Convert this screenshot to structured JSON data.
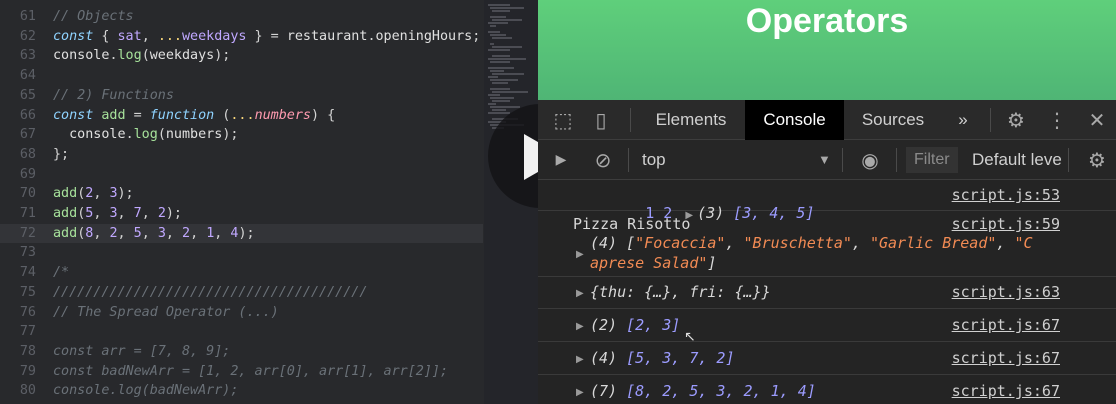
{
  "editor": {
    "lines": [
      {
        "num": "61",
        "tokens": [
          [
            "c",
            "// Objects"
          ]
        ]
      },
      {
        "num": "62",
        "tokens": [
          [
            "k",
            "const"
          ],
          [
            "p",
            " { "
          ],
          [
            "v",
            "sat"
          ],
          [
            "p",
            ", "
          ],
          [
            "o",
            "..."
          ],
          [
            "v",
            "weekdays"
          ],
          [
            "p",
            " } = "
          ],
          [
            "pr",
            "restaurant"
          ],
          [
            "p",
            "."
          ],
          [
            "pr",
            "openingHours"
          ],
          [
            "p",
            ";"
          ]
        ]
      },
      {
        "num": "63",
        "tokens": [
          [
            "pr",
            "console"
          ],
          [
            "p",
            "."
          ],
          [
            "fn",
            "log"
          ],
          [
            "p",
            "("
          ],
          [
            "pr",
            "weekdays"
          ],
          [
            "p",
            ");"
          ]
        ]
      },
      {
        "num": "64",
        "tokens": []
      },
      {
        "num": "65",
        "tokens": [
          [
            "c",
            "// 2) Functions"
          ]
        ]
      },
      {
        "num": "66",
        "tokens": [
          [
            "k",
            "const"
          ],
          [
            "p",
            " "
          ],
          [
            "fn",
            "add"
          ],
          [
            "p",
            " = "
          ],
          [
            "k",
            "function"
          ],
          [
            "p",
            " ("
          ],
          [
            "o",
            "..."
          ],
          [
            "id",
            "numbers"
          ],
          [
            "p",
            ") {"
          ]
        ]
      },
      {
        "num": "67",
        "tokens": [
          [
            "p",
            "  "
          ],
          [
            "pr",
            "console"
          ],
          [
            "p",
            "."
          ],
          [
            "fn",
            "log"
          ],
          [
            "p",
            "("
          ],
          [
            "pr",
            "numbers"
          ],
          [
            "p",
            ");"
          ]
        ]
      },
      {
        "num": "68",
        "tokens": [
          [
            "p",
            "};"
          ]
        ]
      },
      {
        "num": "69",
        "tokens": []
      },
      {
        "num": "70",
        "tokens": [
          [
            "fn",
            "add"
          ],
          [
            "p",
            "("
          ],
          [
            "n",
            "2"
          ],
          [
            "p",
            ", "
          ],
          [
            "n",
            "3"
          ],
          [
            "p",
            ");"
          ]
        ]
      },
      {
        "num": "71",
        "tokens": [
          [
            "fn",
            "add"
          ],
          [
            "p",
            "("
          ],
          [
            "n",
            "5"
          ],
          [
            "p",
            ", "
          ],
          [
            "n",
            "3"
          ],
          [
            "p",
            ", "
          ],
          [
            "n",
            "7"
          ],
          [
            "p",
            ", "
          ],
          [
            "n",
            "2"
          ],
          [
            "p",
            ");"
          ]
        ]
      },
      {
        "num": "72",
        "tokens": [
          [
            "fn",
            "add"
          ],
          [
            "p",
            "("
          ],
          [
            "n",
            "8"
          ],
          [
            "p",
            ", "
          ],
          [
            "n",
            "2"
          ],
          [
            "p",
            ", "
          ],
          [
            "n",
            "5"
          ],
          [
            "p",
            ", "
          ],
          [
            "n",
            "3"
          ],
          [
            "p",
            ", "
          ],
          [
            "n",
            "2"
          ],
          [
            "p",
            ", "
          ],
          [
            "n",
            "1"
          ],
          [
            "p",
            ", "
          ],
          [
            "n",
            "4"
          ],
          [
            "p",
            ");"
          ]
        ],
        "active": true
      },
      {
        "num": "73",
        "tokens": []
      },
      {
        "num": "74",
        "tokens": [
          [
            "c",
            "/*"
          ]
        ]
      },
      {
        "num": "75",
        "tokens": [
          [
            "c",
            "///////////////////////////////////////"
          ]
        ]
      },
      {
        "num": "76",
        "tokens": [
          [
            "c",
            "// The Spread Operator (...)"
          ]
        ]
      },
      {
        "num": "77",
        "tokens": []
      },
      {
        "num": "78",
        "tokens": [
          [
            "c",
            "const arr = [7, 8, 9];"
          ]
        ]
      },
      {
        "num": "79",
        "tokens": [
          [
            "c",
            "const badNewArr = [1, 2, arr[0], arr[1], arr[2]];"
          ]
        ]
      },
      {
        "num": "80",
        "tokens": [
          [
            "c",
            "console.log(badNewArr);"
          ]
        ]
      }
    ]
  },
  "page": {
    "title": "Operators"
  },
  "devtools": {
    "tabs": {
      "elements": "Elements",
      "console": "Console",
      "sources": "Sources",
      "more": "»"
    },
    "icons": {
      "inspect": "⬚",
      "device": "▯",
      "settings": "⚙",
      "menu": "⋮",
      "close": "✕",
      "sidebar": "▶",
      "clear": "⊘",
      "eye": "◉",
      "dropdown": "▼",
      "console_settings": "⚙"
    },
    "context": "top",
    "filter_placeholder": "Filter",
    "levels": "Default levels",
    "messages": [
      {
        "text": "1 2 ",
        "tail": [
          [
            "tri",
            "▶"
          ],
          [
            "it",
            "(3) "
          ],
          [
            "itnum",
            "[3, 4, 5]"
          ]
        ],
        "source": "script.js:53"
      },
      {
        "text": "Pizza Risotto",
        "source": "script.js:59"
      },
      {
        "text": "(4) [\"Focaccia\", \"Bruschetta\", \"Garlic Bread\", \"C",
        "source": ""
      },
      {
        "text": "aprese Salad\"]",
        "source": ""
      },
      {
        "text": "{thu: {…}, fri: {…}}",
        "source": "script.js:63"
      },
      {
        "text": "(2) [2, 3]",
        "source": "script.js:67"
      },
      {
        "text": "(4) [5, 3, 7, 2]",
        "source": "script.js:67"
      },
      {
        "text": "(7) [8, 2, 5, 3, 2, 1, 4]",
        "source": "script.js:67"
      }
    ]
  }
}
